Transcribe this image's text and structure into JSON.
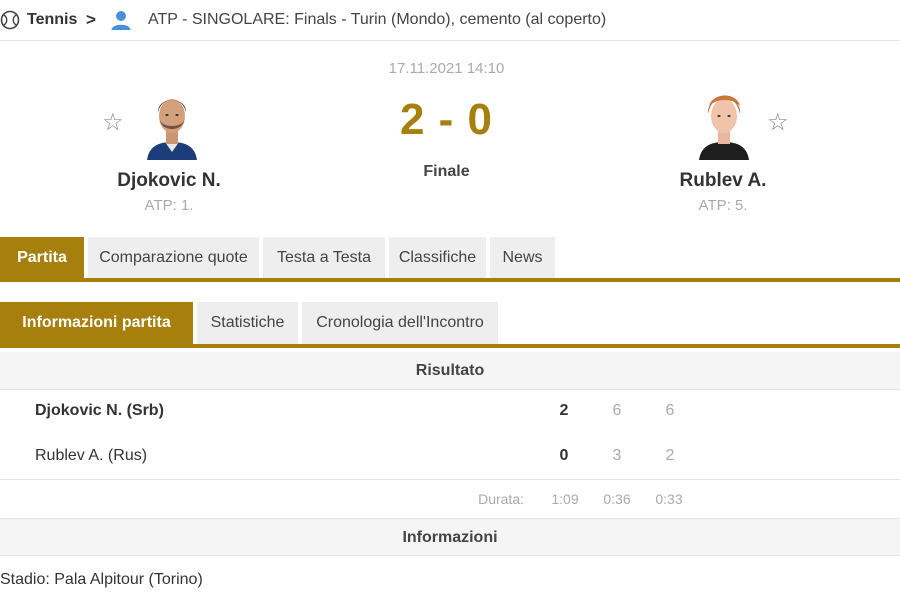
{
  "breadcrumb": {
    "sport": "Tennis",
    "separator": ">",
    "tournament": "ATP - SINGOLARE: Finals - Turin (Mondo), cemento (al coperto)"
  },
  "match": {
    "datetime": "17.11.2021 14:10",
    "score": "2 - 0",
    "status": "Finale"
  },
  "home": {
    "name": "Djokovic N.",
    "rank": "ATP: 1."
  },
  "away": {
    "name": "Rublev A.",
    "rank": "ATP: 5."
  },
  "main_tabs": [
    "Partita",
    "Comparazione quote",
    "Testa a Testa",
    "Classifiche",
    "News"
  ],
  "sub_tabs": [
    "Informazioni partita",
    "Statistiche",
    "Cronologia dell'Incontro"
  ],
  "result": {
    "heading": "Risultato",
    "rows": [
      {
        "player": "Djokovic N. (Srb)",
        "total": "2",
        "set1": "6",
        "set2": "6"
      },
      {
        "player": "Rublev A. (Rus)",
        "total": "0",
        "set1": "3",
        "set2": "2"
      }
    ],
    "duration_label": "Durata:",
    "durations": [
      "1:09",
      "0:36",
      "0:33"
    ]
  },
  "info": {
    "heading": "Informazioni",
    "stadium": "Stadio: Pala Alpitour (Torino)"
  },
  "colors": {
    "accent": "#a77f0d",
    "tab_bg": "#eeeeee",
    "muted": "#aaaaaa"
  },
  "icons": [
    "tennis-ball-icon",
    "person-icon",
    "star-icon"
  ]
}
